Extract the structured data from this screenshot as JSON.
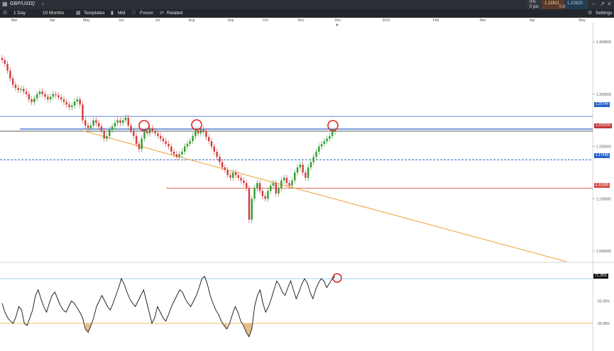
{
  "window": {
    "symbol": "GBP/USD",
    "search_icon": "search-icon",
    "add_icon": "plus-icon",
    "change": "0%",
    "pts": "0 pts",
    "bid": "1.22811",
    "spread": "0.9",
    "ask": "1.22820"
  },
  "toolbar": {
    "interval": "1 Day",
    "range": "10 Months",
    "templates": "Templates",
    "mid": "Mid",
    "forum": "Forum",
    "related": "Related",
    "settings": "Settings"
  },
  "axes": {
    "months": [
      "Mar",
      "Apr",
      "May",
      "Jun",
      "Jul",
      "Aug",
      "Sep",
      "Oct",
      "Nov",
      "Dec",
      "2023",
      "Feb",
      "Mar",
      "Apr",
      "May"
    ],
    "price_ticks": [
      "1.400000",
      "1.300000",
      "1.200000",
      "1.100000",
      "1.000000"
    ],
    "rsi_ticks": [
      "50.00%",
      "30.00%"
    ]
  },
  "tags": {
    "blue_top": "1.25744",
    "current": "1.229155",
    "blue_dashed": "1.17448",
    "red": "1.12026",
    "rsi": "71.35%"
  },
  "colors": {
    "up": "#2e9c2e",
    "down": "#d23b3b",
    "trend": "#f0a030",
    "blue_line": "#2a63c7",
    "red_line": "#d9534f"
  },
  "chart_data": {
    "type": "candlestick",
    "instrument": "GBP/USD",
    "y_ticks": [
      1.4,
      1.3,
      1.2,
      1.1,
      1.0
    ],
    "price_levels": [
      1.25744,
      1.229155,
      1.17448,
      1.12026
    ],
    "closes": [
      1.365,
      1.358,
      1.345,
      1.33,
      1.318,
      1.312,
      1.308,
      1.31,
      1.305,
      1.3,
      1.29,
      1.285,
      1.292,
      1.3,
      1.305,
      1.3,
      1.295,
      1.29,
      1.295,
      1.3,
      1.298,
      1.294,
      1.29,
      1.285,
      1.28,
      1.275,
      1.278,
      1.286,
      1.29,
      1.28,
      1.25,
      1.24,
      1.235,
      1.24,
      1.25,
      1.245,
      1.238,
      1.23,
      1.215,
      1.22,
      1.232,
      1.238,
      1.245,
      1.25,
      1.245,
      1.25,
      1.255,
      1.24,
      1.23,
      1.22,
      1.205,
      1.195,
      1.215,
      1.228,
      1.225,
      1.235,
      1.23,
      1.225,
      1.22,
      1.215,
      1.21,
      1.205,
      1.2,
      1.19,
      1.185,
      1.18,
      1.185,
      1.19,
      1.2,
      1.205,
      1.21,
      1.22,
      1.23,
      1.225,
      1.232,
      1.228,
      1.218,
      1.21,
      1.2,
      1.19,
      1.18,
      1.17,
      1.16,
      1.155,
      1.145,
      1.14,
      1.15,
      1.145,
      1.14,
      1.135,
      1.13,
      1.12,
      1.06,
      1.1,
      1.12,
      1.13,
      1.115,
      1.105,
      1.1,
      1.115,
      1.125,
      1.13,
      1.11,
      1.12,
      1.135,
      1.14,
      1.13,
      1.125,
      1.135,
      1.15,
      1.16,
      1.165,
      1.15,
      1.14,
      1.16,
      1.17,
      1.18,
      1.19,
      1.2,
      1.205,
      1.21,
      1.215,
      1.22,
      1.228,
      1.23
    ],
    "rsi_levels": [
      70,
      30
    ],
    "rsi": [
      48,
      40,
      35,
      32,
      30,
      36,
      45,
      42,
      30,
      28,
      35,
      42,
      55,
      60,
      52,
      45,
      40,
      48,
      55,
      58,
      52,
      46,
      42,
      40,
      45,
      50,
      48,
      44,
      40,
      35,
      25,
      22,
      28,
      35,
      45,
      50,
      55,
      50,
      45,
      42,
      48,
      55,
      62,
      70,
      65,
      58,
      52,
      48,
      45,
      50,
      55,
      60,
      50,
      40,
      30,
      35,
      45,
      40,
      35,
      32,
      38,
      45,
      50,
      55,
      60,
      58,
      52,
      48,
      45,
      50,
      55,
      62,
      70,
      72,
      65,
      55,
      48,
      42,
      38,
      32,
      28,
      25,
      30,
      38,
      45,
      40,
      32,
      28,
      22,
      18,
      25,
      45,
      55,
      60,
      48,
      40,
      45,
      52,
      60,
      68,
      64,
      58,
      55,
      62,
      68,
      60,
      52,
      58,
      65,
      70,
      66,
      58,
      52,
      60,
      66,
      70,
      68,
      62,
      66,
      70,
      72
    ]
  }
}
